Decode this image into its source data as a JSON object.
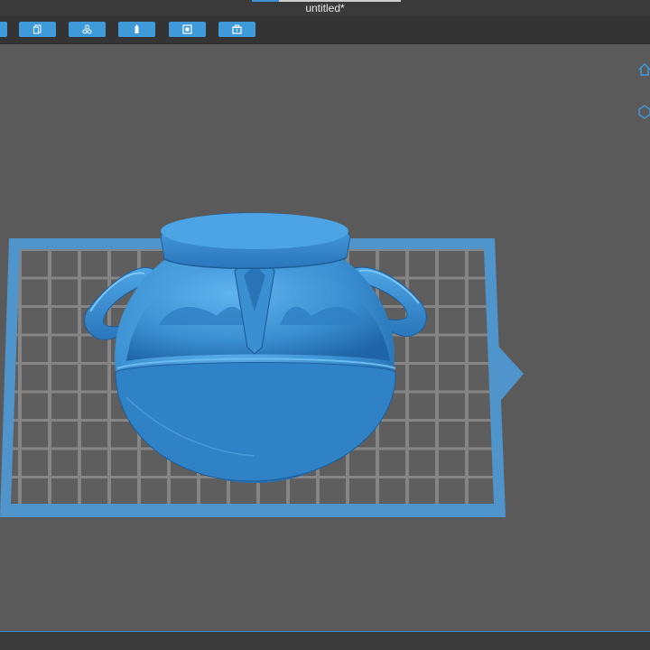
{
  "window": {
    "title": "untitled*"
  },
  "toolbar": {
    "buttons": [
      {
        "icon": "open-file-icon"
      },
      {
        "icon": "copy-icon"
      },
      {
        "icon": "auto-arrange-icon"
      },
      {
        "icon": "supports-icon"
      },
      {
        "icon": "slice-frame-icon"
      },
      {
        "icon": "print-box-icon"
      }
    ]
  },
  "viewport": {
    "model": "pot-with-handles",
    "view_buttons": [
      {
        "icon": "home-view-icon"
      },
      {
        "icon": "view-cube-icon"
      }
    ]
  },
  "colors": {
    "accent": "#3e9ad9",
    "model": "#3a8fd0",
    "background": "#5a5a5a",
    "toolbar": "#343434"
  }
}
